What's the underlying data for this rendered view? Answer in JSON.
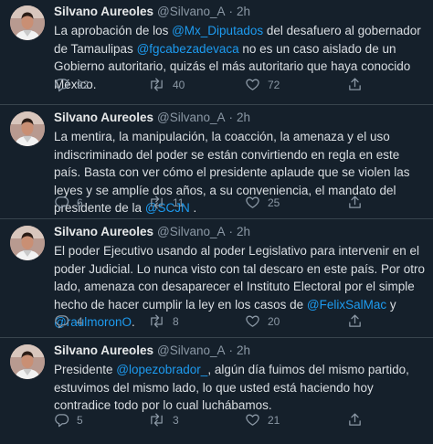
{
  "tweets": [
    {
      "name": "Silvano Aureoles",
      "handle": "@Silvano_A",
      "sep": "·",
      "time": "2h",
      "text": [
        {
          "t": "La aprobación de los "
        },
        {
          "t": "@Mx_Diputados",
          "m": true
        },
        {
          "t": " del desafuero al gobernador de Tamaulipas "
        },
        {
          "t": "@fgcabezadevaca",
          "m": true
        },
        {
          "t": " no es un caso aislado de un Gobierno autoritario, quizás el más autoritario que haya conocido México."
        }
      ],
      "replies": "92",
      "retweets": "40",
      "likes": "72"
    },
    {
      "name": "Silvano Aureoles",
      "handle": "@Silvano_A",
      "sep": "·",
      "time": "2h",
      "text": [
        {
          "t": "La mentira, la manipulación, la coacción, la amenaza y el uso indiscriminado del poder se están convirtiendo en regla en este país. Basta con ver cómo el presidente aplaude que se violen las leyes y se amplíe dos años, a su conveniencia, el mandato del presidente de la "
        },
        {
          "t": "@SCJN",
          "m": true
        },
        {
          "t": " ."
        }
      ],
      "replies": "6",
      "retweets": "11",
      "likes": "25"
    },
    {
      "name": "Silvano Aureoles",
      "handle": "@Silvano_A",
      "sep": "·",
      "time": "2h",
      "text": [
        {
          "t": "El poder Ejecutivo usando al poder Legislativo para intervenir en el poder Judicial. Lo nunca visto con tal descaro en este país. Por otro lado, amenaza con desaparecer el Instituto Electoral por el simple hecho de hacer cumplir la ley en los casos de "
        },
        {
          "t": "@FelixSalMac",
          "m": true
        },
        {
          "t": " y "
        },
        {
          "t": "@raulmoronO",
          "m": true
        },
        {
          "t": "."
        }
      ],
      "replies": "4",
      "retweets": "8",
      "likes": "20"
    },
    {
      "name": "Silvano Aureoles",
      "handle": "@Silvano_A",
      "sep": "·",
      "time": "2h",
      "text": [
        {
          "t": "Presidente "
        },
        {
          "t": "@lopezobrador_",
          "m": true
        },
        {
          "t": ", algún día fuimos del mismo partido, estuvimos del mismo lado, lo que usted está haciendo hoy contradice todo por lo cual luchábamos."
        }
      ],
      "replies": "5",
      "retweets": "3",
      "likes": "21"
    }
  ],
  "colors": {
    "background": "#15202b",
    "mention": "#1d9bf0",
    "secondary": "#8b98a5",
    "divider": "#38444d"
  },
  "icons": [
    "reply-icon",
    "retweet-icon",
    "like-icon",
    "share-icon"
  ]
}
